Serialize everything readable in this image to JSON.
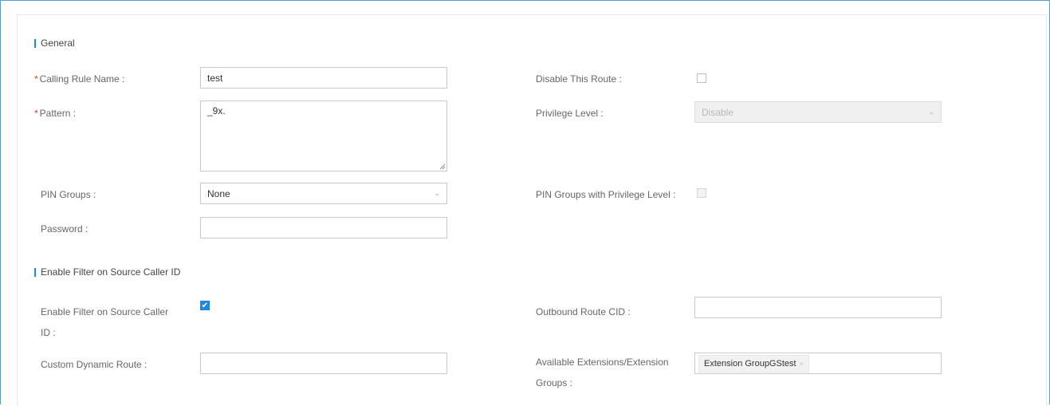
{
  "sections": {
    "general": "General",
    "filter": "Enable Filter on Source Caller ID"
  },
  "fields": {
    "calling_rule_name": {
      "label": "Calling Rule Name :",
      "value": "test"
    },
    "pattern": {
      "label": "Pattern :",
      "value": "_9x."
    },
    "pin_groups": {
      "label": "PIN Groups :",
      "value": "None"
    },
    "password": {
      "label": "Password :",
      "value": ""
    },
    "disable_route": {
      "label": "Disable This Route :",
      "checked": false
    },
    "privilege_level": {
      "label": "Privilege Level :",
      "value": "Disable"
    },
    "pin_groups_privilege": {
      "label": "PIN Groups with Privilege Level :",
      "checked": false
    },
    "enable_filter": {
      "label_line1": "Enable Filter on Source Caller",
      "label_line2": "ID :",
      "checked": true
    },
    "outbound_route_cid": {
      "label": "Outbound Route CID :",
      "value": ""
    },
    "custom_dynamic_route": {
      "label": "Custom Dynamic Route :",
      "value": ""
    },
    "available_extensions": {
      "label_line1": "Available Extensions/Extension",
      "label_line2": "Groups :",
      "tags": [
        "Extension GroupGStest"
      ]
    }
  },
  "icons": {
    "checkmark": "✔",
    "chevron": "⌄",
    "tag_remove": "×"
  },
  "colors": {
    "accent": "#1e88e5",
    "required": "#e53935"
  }
}
